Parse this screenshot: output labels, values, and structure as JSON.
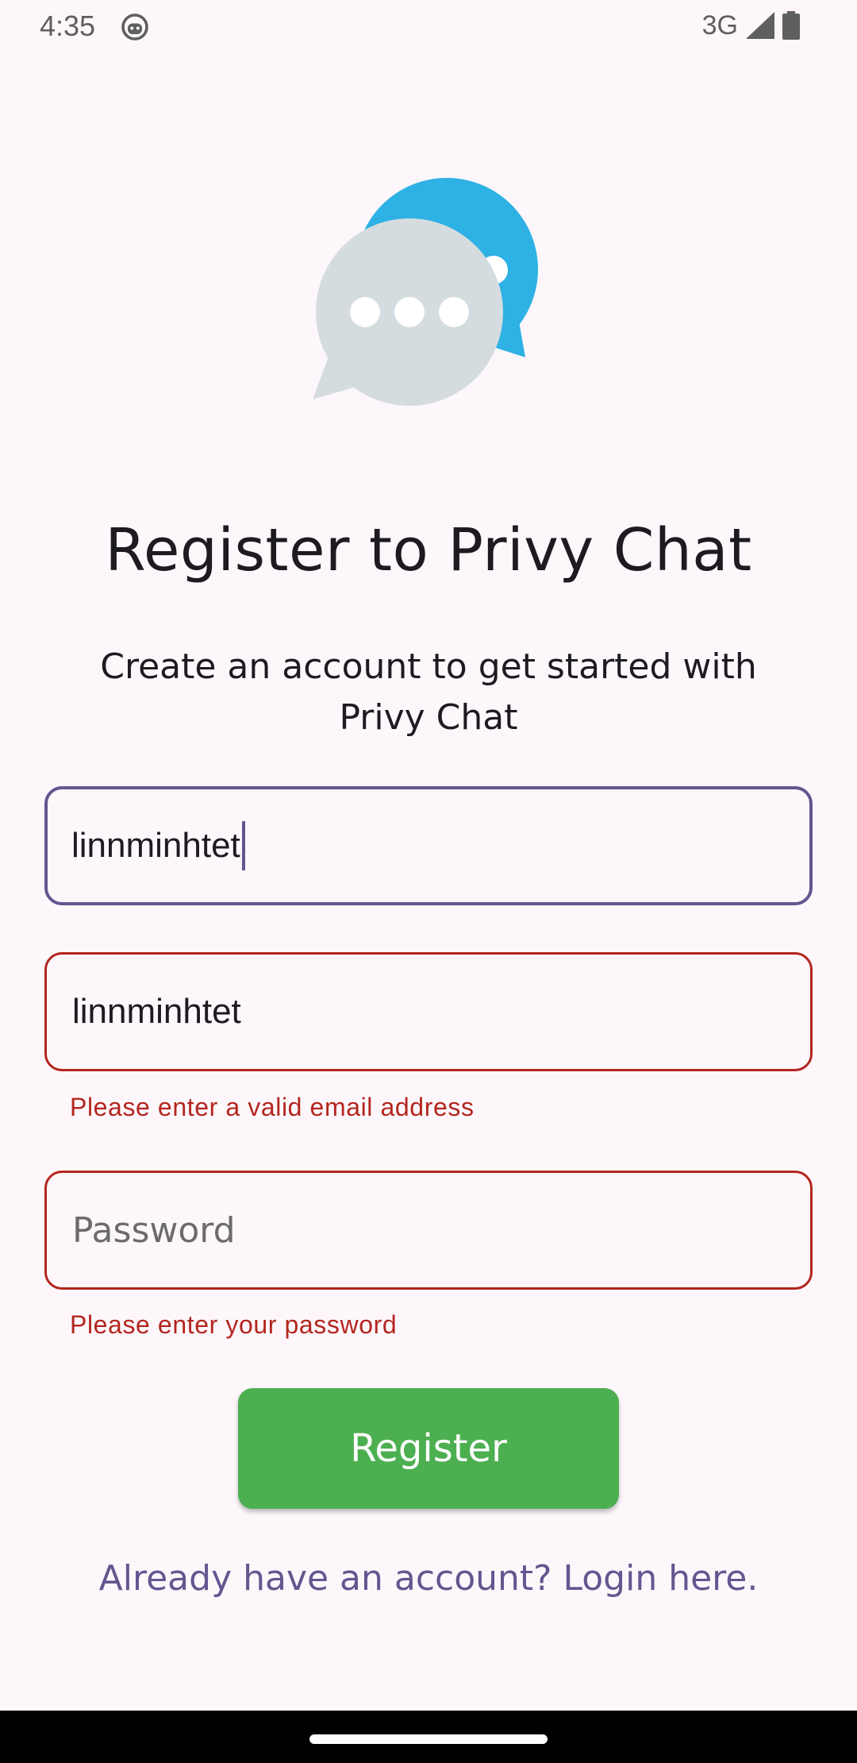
{
  "status_bar": {
    "time": "4:35",
    "network": "3G",
    "icons": [
      "robot-icon",
      "signal-icon",
      "battery-icon"
    ]
  },
  "logo": {
    "icon": "chat-bubbles-icon",
    "colors": {
      "front_bubble": "#D5DCDF",
      "back_bubble": "#2EB1E4"
    }
  },
  "header": {
    "title": "Register to Privy Chat",
    "subtitle": "Create an account to get started with Privy Chat"
  },
  "form": {
    "username": {
      "value": "linnminhtet",
      "focused": true
    },
    "email": {
      "value": "linnminhtet",
      "error": "Please enter a valid email address"
    },
    "password": {
      "value": "",
      "placeholder": "Password",
      "error": "Please enter your password"
    }
  },
  "actions": {
    "register_label": "Register",
    "login_link": "Already have an account? Login here."
  },
  "colors": {
    "background": "#FDF7FB",
    "primary": "#65558F",
    "error": "#B3261E",
    "register_button": "#4CAF50"
  }
}
